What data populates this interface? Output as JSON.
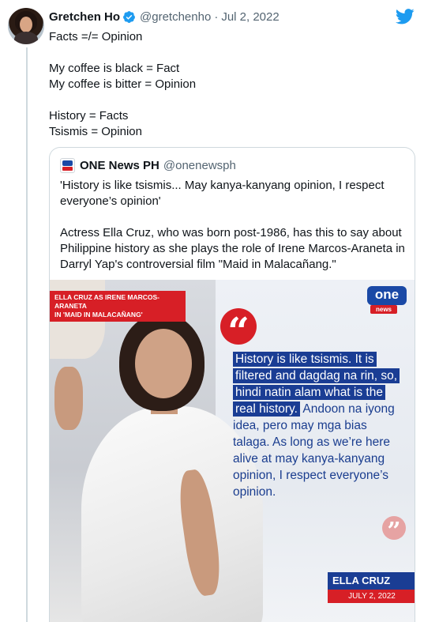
{
  "tweet": {
    "author_name": "Gretchen Ho",
    "handle": "@gretchenho",
    "separator": "·",
    "date": "Jul 2, 2022",
    "lines": [
      "Facts =/= Opinion",
      "",
      "My coffee is black = Fact",
      "My coffee is bitter = Opinion",
      "",
      "History = Facts",
      "Tsismis = Opinion"
    ]
  },
  "quoted": {
    "source_name": "ONE News PH",
    "source_handle": "@onenewsph",
    "paragraph1": "'History is like tsismis... May kanya-kanyang opinion, I respect everyone’s opinion'",
    "paragraph2": "Actress Ella Cruz, who was born post-1986, has this to say about Philippine history as she plays the role of Irene Marcos-Araneta in Darryl Yap's controversial film \"Maid in Malacañang.\""
  },
  "media": {
    "caption_line1": "ELLA CRUZ AS IRENE MARCOS-ARANETA",
    "caption_line2": "IN 'MAID IN MALACAÑANG'",
    "logo_top": "one",
    "logo_bottom": "news",
    "quote_highlighted": "History is like tsismis. It is filtered and dagdag na rin, so, hindi natin alam what is the real history.",
    "quote_rest": " Andoon na iyong idea, pero may mga bias talaga. As long as we’re here alive at may kanya-kanyang opinion, I respect everyone’s opinion.",
    "open_quote": "“",
    "close_quote": "”",
    "name_tag": "ELLA CRUZ",
    "name_date": "JULY 2, 2022"
  },
  "colors": {
    "verified_blue": "#1d9bf0",
    "twitter_blue": "#1d9bf0",
    "news_blue": "#1a3d94",
    "news_red": "#d71f26"
  },
  "icons": [
    "verified-badge-icon",
    "twitter-bird-icon",
    "quote-mark-icon"
  ]
}
